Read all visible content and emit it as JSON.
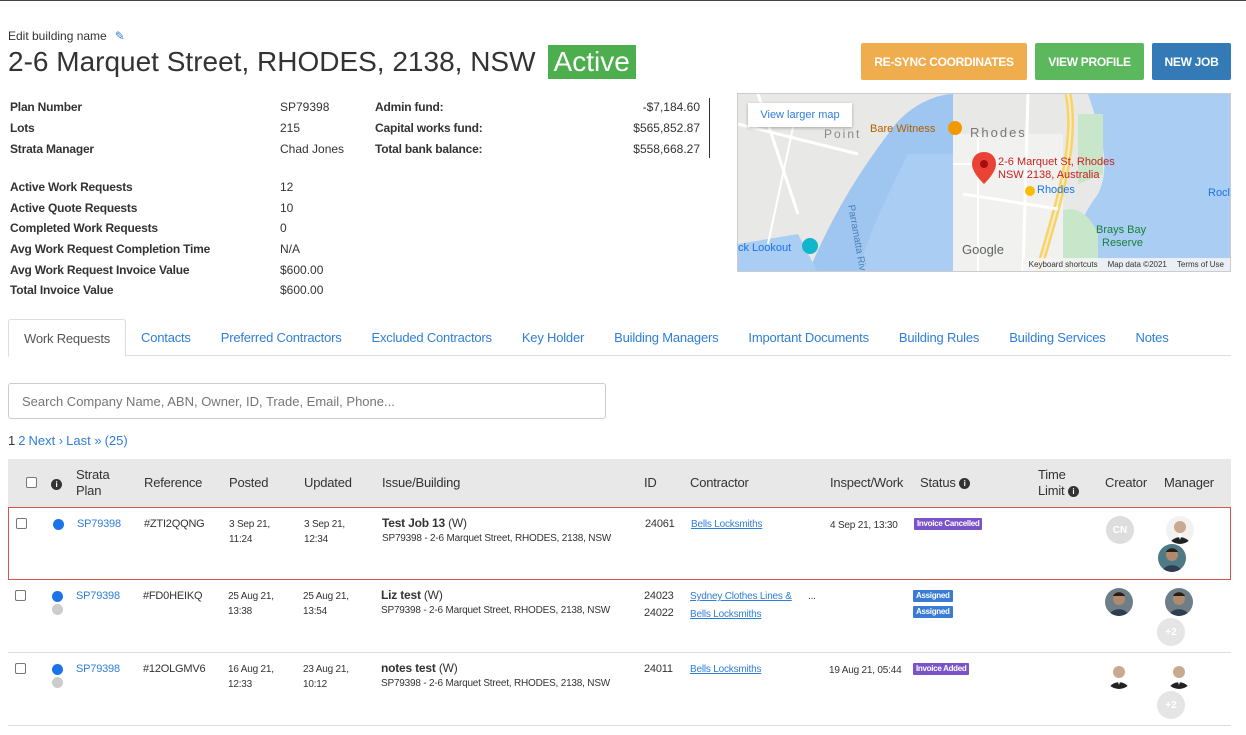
{
  "header": {
    "edit_label": "Edit building name",
    "title": "2-6 Marquet Street, RHODES, 2138, NSW",
    "status": "Active",
    "buttons": {
      "resync": "RE-SYNC COORDINATES",
      "profile": "VIEW PROFILE",
      "newjob": "NEW JOB"
    }
  },
  "info": {
    "plan_number_label": "Plan Number",
    "plan_number": "SP79398",
    "lots_label": "Lots",
    "lots": "215",
    "manager_label": "Strata Manager",
    "manager": "Chad Jones",
    "active_wr_label": "Active Work Requests",
    "active_wr": "12",
    "active_qr_label": "Active Quote Requests",
    "active_qr": "10",
    "completed_wr_label": "Completed Work Requests",
    "completed_wr": "0",
    "avg_time_label": "Avg Work Request Completion Time",
    "avg_time": "N/A",
    "avg_invoice_label": "Avg Work Request Invoice Value",
    "avg_invoice": "$600.00",
    "total_invoice_label": "Total Invoice Value",
    "total_invoice": "$600.00"
  },
  "funds": {
    "admin_label": "Admin fund:",
    "admin": "-$7,184.60",
    "capital_label": "Capital works fund:",
    "capital": "$565,852.87",
    "total_label": "Total bank balance:",
    "total": "$558,668.27"
  },
  "map": {
    "larger_map": "View larger map",
    "place_line1": "2-6 Marquet St, Rhodes",
    "place_line2": "NSW 2138, Australia",
    "bare_witness": "Bare Witness",
    "rhodes": "Rhodes",
    "rhodes_station": "Rhodes",
    "brays_bay": "Brays Bay",
    "reserve": "Reserve",
    "lookout": "ck Lookout",
    "point": "Point",
    "river": "Parramatta River",
    "roc": "Rocl",
    "google": "Google",
    "footer_shortcuts": "Keyboard shortcuts",
    "footer_data": "Map data ©2021",
    "footer_terms": "Terms of Use"
  },
  "tabs": [
    "Work Requests",
    "Contacts",
    "Preferred Contractors",
    "Excluded Contractors",
    "Key Holder",
    "Building Managers",
    "Important Documents",
    "Building Rules",
    "Building Services",
    "Notes"
  ],
  "search": {
    "placeholder": "Search Company Name, ABN, Owner, ID, Trade, Email, Phone..."
  },
  "pager": {
    "current": "1",
    "page2": "2",
    "next": "Next ›",
    "last": "Last »",
    "count": "(25)"
  },
  "table": {
    "headers": {
      "strata_plan_1": "Strata",
      "strata_plan_2": "Plan",
      "reference": "Reference",
      "posted": "Posted",
      "updated": "Updated",
      "issue": "Issue/Building",
      "id": "ID",
      "contractor": "Contractor",
      "inspect": "Inspect/Work",
      "status": "Status",
      "time_limit_1": "Time",
      "time_limit_2": "Limit",
      "creator": "Creator",
      "manager": "Manager"
    },
    "rows": [
      {
        "plan": "SP79398",
        "reference": "#ZTI2QQNG",
        "posted_date": "3 Sep 21,",
        "posted_time": "11:24",
        "updated_date": "3 Sep 21,",
        "updated_time": "12:34",
        "issue_title": "Test Job 13",
        "issue_type": "(W)",
        "issue_building": "SP79398 - 2-6 Marquet Street, RHODES, 2138, NSW",
        "id1": "24061",
        "id2": "",
        "contractor1": "Bells Locksmiths",
        "contractor2": "",
        "inspect": "4 Sep 21, 13:30",
        "status1": "Invoice Cancelled",
        "status2": "",
        "creator": "CN",
        "manager_extra": ""
      },
      {
        "plan": "SP79398",
        "reference": "#FD0HEIKQ",
        "posted_date": "25 Aug 21,",
        "posted_time": "13:38",
        "updated_date": "25 Aug 21,",
        "updated_time": "13:54",
        "issue_title": "Liz test",
        "issue_type": "(W)",
        "issue_building": "SP79398 - 2-6 Marquet Street, RHODES, 2138, NSW",
        "id1": "24023",
        "id2": "24022",
        "contractor1": "Sydney Clothes Lines &",
        "contractor2": "Bells Locksmiths",
        "inspect": "...",
        "status1": "Assigned",
        "status2": "Assigned",
        "creator": "",
        "manager_extra": "+2"
      },
      {
        "plan": "SP79398",
        "reference": "#12OLGMV6",
        "posted_date": "16 Aug 21,",
        "posted_time": "12:33",
        "updated_date": "23 Aug 21,",
        "updated_time": "10:12",
        "issue_title": "notes test",
        "issue_type": "(W)",
        "issue_building": "SP79398 - 2-6 Marquet Street, RHODES, 2138, NSW",
        "id1": "24011",
        "id2": "",
        "contractor1": "Bells Locksmiths",
        "contractor2": "",
        "inspect": "19 Aug 21, 05:44",
        "status1": "Invoice Added",
        "status2": "",
        "creator": "",
        "manager_extra": "+2"
      }
    ]
  },
  "colors": {
    "active": "#4cae4c",
    "resync": "#f0ad4e",
    "profile": "#5cb85c",
    "newjob": "#337ab7",
    "link": "#2f7ed8",
    "highlight_border": "#d9534f",
    "badge_purple": "#7a53c9",
    "badge_blue": "#3a7bd5"
  }
}
